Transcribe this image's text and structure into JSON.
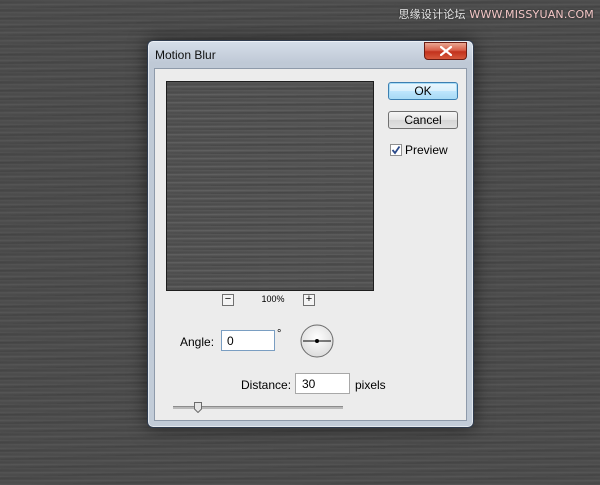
{
  "watermark": {
    "site_name": "思缘设计论坛",
    "url": "WWW.MISSYUAN.COM"
  },
  "dialog": {
    "title": "Motion Blur",
    "buttons": {
      "ok": "OK",
      "cancel": "Cancel"
    },
    "preview": {
      "label": "Preview",
      "checked": true
    },
    "zoom": {
      "minus": "−",
      "plus": "+",
      "level": "100%"
    },
    "angle": {
      "label": "Angle:",
      "value": "0",
      "unit": "°"
    },
    "distance": {
      "label": "Distance:",
      "value": "30",
      "unit": "pixels",
      "slider_value": 30,
      "slider_min": 1,
      "slider_max": 999
    }
  },
  "icons": {
    "close": "close-icon",
    "checkmark": "checkmark-icon",
    "dial": "angle-dial-icon"
  },
  "colors": {
    "desktop_bg": "#4a4a4a",
    "close_button": "#c2321d",
    "ok_focus": "#3c7fb1",
    "dialog_bg": "#ececec"
  }
}
